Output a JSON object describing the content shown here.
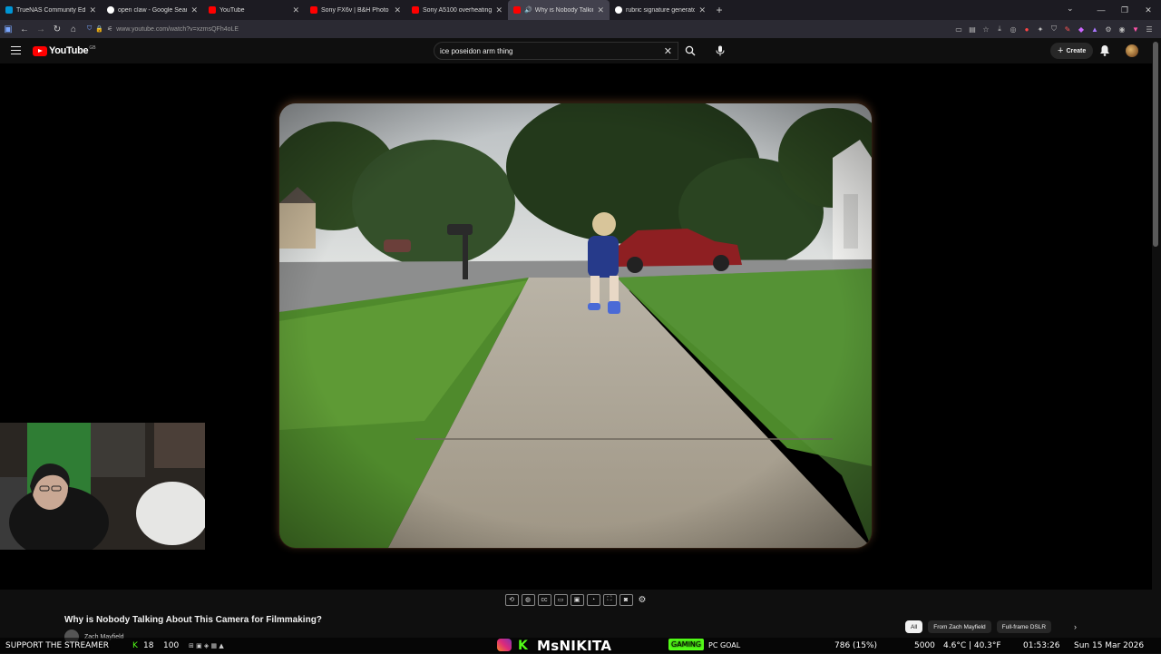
{
  "browser": {
    "tabs": [
      {
        "label": "TrueNAS Community Edition | M",
        "favicon_color": "#0095d5"
      },
      {
        "label": "open claw - Google Search",
        "favicon_color": "#ffffff"
      },
      {
        "label": "YouTube",
        "favicon_color": "#ff0000"
      },
      {
        "label": "Sony FX6v | B&H Photo Video",
        "favicon_color": "#ff0000"
      },
      {
        "label": "Sony A5100 overheating probl",
        "favicon_color": "#ff0000"
      },
      {
        "label": "Why is Nobody Talking Ab",
        "favicon_color": "#ff0000",
        "active": true
      },
      {
        "label": "rubric signature generator - Go",
        "favicon_color": "#ffffff"
      }
    ],
    "new_tab_label": "+",
    "url": "www.youtube.com/watch?v=xzmsQFh4oLE"
  },
  "youtube": {
    "logo_text": "YouTube",
    "logo_country": "GB",
    "search_value": "ice poseidon arm thing",
    "create_label": "Create",
    "video_title": "Why is Nobody Talking About This Camera for Filmmaking?",
    "channel_name": "Zach Mayfield",
    "chips": [
      "All",
      "From Zach Mayfield",
      "Full-frame DSLR"
    ]
  },
  "stream_overlay": {
    "support_text": "SUPPORT THE STREAMER",
    "kick_count": "18",
    "viewer_count": "100",
    "handle": "MsNIKITA",
    "goal_pill": "GAMING",
    "goal_text": "PC GOAL",
    "goal_progress": "786 (15%)",
    "goal_target": "5000",
    "weather": "4.6°C | 40.3°F",
    "time": "01:53:26",
    "date": "Sun 15 Mar 2026"
  },
  "colors": {
    "youtube_red": "#ff0000",
    "kick_green": "#53fc18",
    "page_bg": "#0f0f0f"
  }
}
